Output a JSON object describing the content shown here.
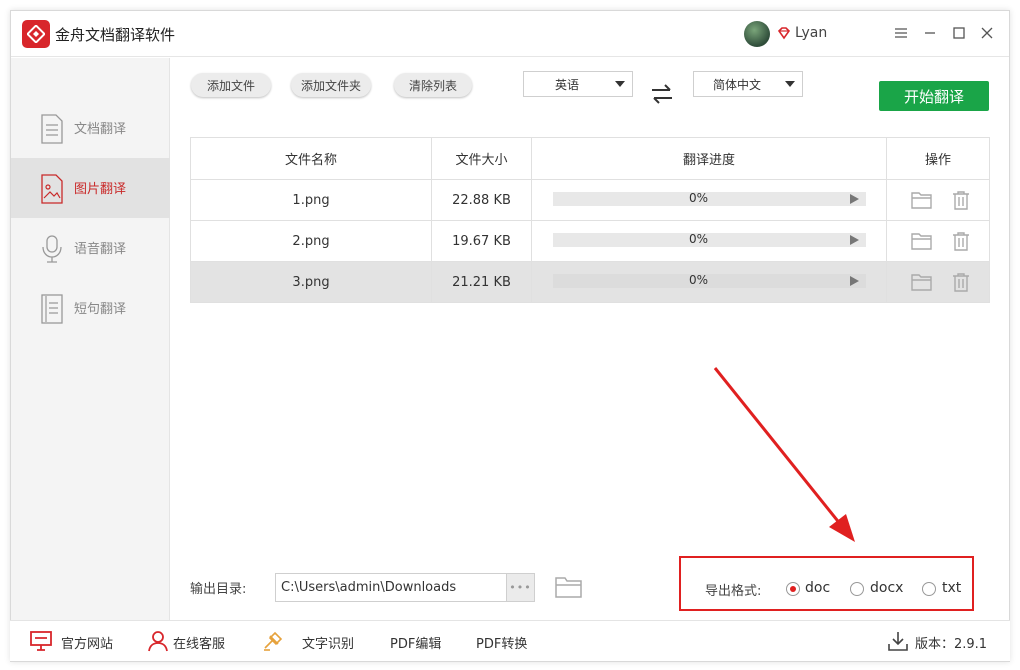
{
  "app": {
    "title": "金舟文档翻译软件",
    "user": "Lyan"
  },
  "sidebar": {
    "items": [
      {
        "label": "文档翻译",
        "icon": "document-icon"
      },
      {
        "label": "图片翻译",
        "icon": "image-icon",
        "active": true
      },
      {
        "label": "语音翻译",
        "icon": "microphone-icon"
      },
      {
        "label": "短句翻译",
        "icon": "text-icon"
      }
    ]
  },
  "toolbar": {
    "add_file": "添加文件",
    "add_folder": "添加文件夹",
    "clear_list": "清除列表",
    "source_lang": "英语",
    "target_lang": "简体中文",
    "start": "开始翻译"
  },
  "table": {
    "headers": [
      "文件名称",
      "文件大小",
      "翻译进度",
      "操作"
    ],
    "rows": [
      {
        "name": "1.png",
        "size": "22.88 KB",
        "progress": "0%"
      },
      {
        "name": "2.png",
        "size": "19.67 KB",
        "progress": "0%"
      },
      {
        "name": "3.png",
        "size": "21.21 KB",
        "progress": "0%",
        "selected": true
      }
    ]
  },
  "output": {
    "label": "输出目录:",
    "path": "C:\\Users\\admin\\Downloads",
    "browse": "•••"
  },
  "export": {
    "label": "导出格式:",
    "options": [
      "doc",
      "docx",
      "txt"
    ],
    "selected": "doc"
  },
  "footer": {
    "official_site": "官方网站",
    "online_service": "在线客服",
    "ocr": "文字识别",
    "pdf_edit": "PDF编辑",
    "pdf_convert": "PDF转换",
    "version": "版本：2.9.1"
  },
  "colors": {
    "accent_red": "#d8262b",
    "start_green": "#1aa548",
    "annotation_red": "#e02020"
  }
}
